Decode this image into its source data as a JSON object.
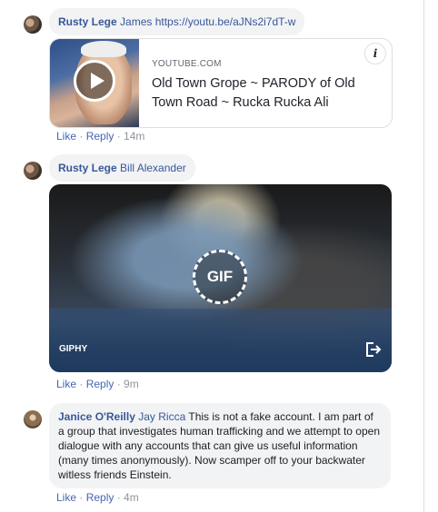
{
  "comments": [
    {
      "author": "Rusty Lege",
      "tag": "James",
      "link": "https://youtu.be/aJNs2i7dT-w",
      "preview": {
        "domain": "YOUTUBE.COM",
        "title": "Old Town Grope ~ PARODY of Old Town Road ~ Rucka Rucka Ali",
        "info": "i"
      },
      "actions": {
        "like": "Like",
        "sep": " · ",
        "reply": "Reply",
        "time": "14m"
      }
    },
    {
      "author": "Rusty Lege",
      "tag": "Bill Alexander",
      "gif": {
        "badge": "GIF",
        "source": "GIPHY"
      },
      "actions": {
        "like": "Like",
        "sep": " · ",
        "reply": "Reply",
        "time": "9m"
      }
    },
    {
      "author": "Janice O'Reilly",
      "tag": "Jay Ricca",
      "text": "This is not a fake account. I am part of a group that investigates human trafficking and we attempt to open dialogue with any accounts that can give us useful information (many times anonymously). Now scamper off to your backwater witless friends Einstein.",
      "actions": {
        "like": "Like",
        "sep": " · ",
        "reply": "Reply",
        "time": "4m"
      }
    }
  ]
}
